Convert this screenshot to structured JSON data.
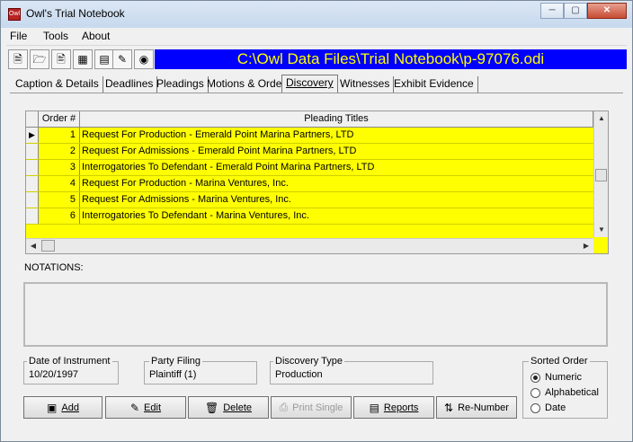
{
  "window": {
    "title": "Owl's Trial Notebook",
    "icon_text": "Owl"
  },
  "menu": [
    {
      "label": "File"
    },
    {
      "label": "Tools"
    },
    {
      "label": "About"
    }
  ],
  "toolbar": {
    "path": "C:\\Owl Data Files\\Trial Notebook\\p-97076.odi",
    "icons": [
      "new-file-icon",
      "open-folder-icon",
      "document-icon",
      "calendar-icon",
      "calculator-icon",
      "pen-icon",
      "globe-icon"
    ],
    "path_bg": "#0000ff",
    "path_fg": "#ffff00"
  },
  "tabs": [
    {
      "label": "Caption & Details"
    },
    {
      "label": "Deadlines"
    },
    {
      "label": "Pleadings"
    },
    {
      "label": "Motions & Orders"
    },
    {
      "label": "Discovery",
      "active": true
    },
    {
      "label": "Witnesses"
    },
    {
      "label": "Exhibit Evidence"
    }
  ],
  "grid": {
    "headers": {
      "order": "Order #",
      "title": "Pleading Titles"
    },
    "row_color": "#ffff00",
    "rows": [
      {
        "order": "1",
        "title": "Request For Production - Emerald Point Marina Partners, LTD"
      },
      {
        "order": "2",
        "title": "Request For Admissions - Emerald Point Marina Partners, LTD"
      },
      {
        "order": "3",
        "title": "Interrogatories To Defendant - Emerald Point Marina Partners, LTD"
      },
      {
        "order": "4",
        "title": "Request For Production - Marina Ventures, Inc."
      },
      {
        "order": "5",
        "title": "Request For Admissions - Marina Ventures, Inc."
      },
      {
        "order": "6",
        "title": "Interrogatories To Defendant - Marina Ventures, Inc."
      }
    ]
  },
  "notations": {
    "label": "NOTATIONS:",
    "value": ""
  },
  "fields": {
    "date": {
      "label": "Date of Instrument",
      "value": "10/20/1997"
    },
    "party": {
      "label": "Party Filing",
      "value": "Plaintiff (1)"
    },
    "type": {
      "label": "Discovery Type",
      "value": "Production"
    }
  },
  "sorted": {
    "label": "Sorted Order",
    "options": [
      "Numeric",
      "Alphabetical",
      "Date"
    ],
    "selected": "Numeric"
  },
  "buttons": {
    "add": "Add",
    "edit": "Edit",
    "delete": "Delete",
    "print": "Print Single",
    "reports": "Reports",
    "renumber": "Re-Number"
  }
}
